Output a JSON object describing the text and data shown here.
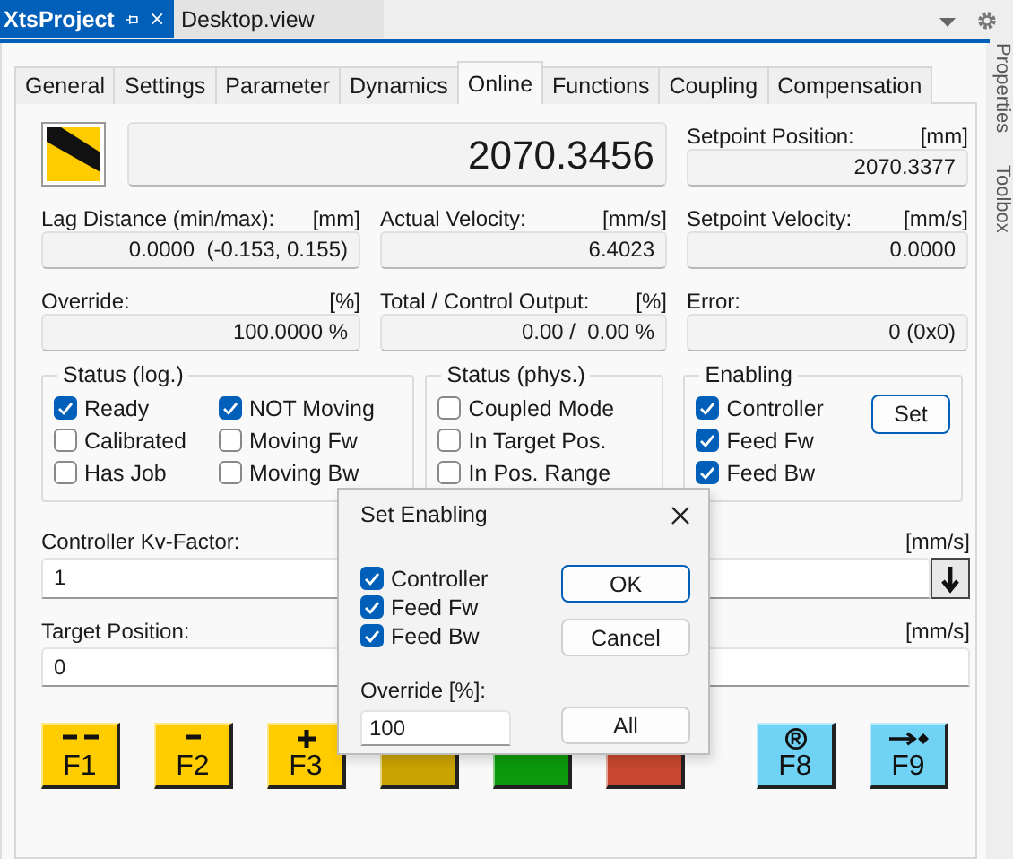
{
  "doc_tabs": [
    {
      "label": "XtsProject",
      "selected": true
    },
    {
      "label": "Desktop.view",
      "selected": false
    }
  ],
  "side_panels": [
    "Properties",
    "Toolbox"
  ],
  "tabs": [
    {
      "label": "General",
      "selected": false
    },
    {
      "label": "Settings",
      "selected": false
    },
    {
      "label": "Parameter",
      "selected": false
    },
    {
      "label": "Dynamics",
      "selected": false
    },
    {
      "label": "Online",
      "selected": true
    },
    {
      "label": "Functions",
      "selected": false
    },
    {
      "label": "Coupling",
      "selected": false
    },
    {
      "label": "Compensation",
      "selected": false
    }
  ],
  "position": {
    "value": "2070.3456"
  },
  "setpoint_position": {
    "label": "Setpoint Position:",
    "unit": "[mm]",
    "value": "2070.3377"
  },
  "field_rows": [
    [
      {
        "label": "Lag Distance (min/max):",
        "unit": "[mm]",
        "value": "0.0000  (-0.153, 0.155)"
      },
      {
        "label": "Actual Velocity:",
        "unit": "[mm/s]",
        "value": "6.4023"
      },
      {
        "label": "Setpoint Velocity:",
        "unit": "[mm/s]",
        "value": "0.0000"
      }
    ],
    [
      {
        "label": "Override:",
        "unit": "[%]",
        "value": "100.0000 %"
      },
      {
        "label": "Total / Control Output:",
        "unit": "[%]",
        "value": "0.00 /  0.00 %"
      },
      {
        "label": "Error:",
        "value": "0 (0x0)"
      }
    ]
  ],
  "status_log": {
    "title": "Status (log.)",
    "items": [
      {
        "label": "Ready",
        "checked": true
      },
      {
        "label": "NOT Moving",
        "checked": true
      },
      {
        "label": "Calibrated",
        "checked": false
      },
      {
        "label": "Moving Fw",
        "checked": false
      },
      {
        "label": "Has Job",
        "checked": false
      },
      {
        "label": "Moving Bw",
        "checked": false
      }
    ]
  },
  "status_phys": {
    "title": "Status (phys.)",
    "items": [
      {
        "label": "Coupled Mode",
        "checked": false
      },
      {
        "label": "In Target Pos.",
        "checked": false
      },
      {
        "label": "In Pos. Range",
        "checked": false
      }
    ]
  },
  "enabling": {
    "title": "Enabling",
    "items": [
      {
        "label": "Controller",
        "checked": true
      },
      {
        "label": "Feed Fw",
        "checked": true
      },
      {
        "label": "Feed Bw",
        "checked": true
      }
    ],
    "button": "Set"
  },
  "kv": {
    "label": "Controller Kv-Factor:",
    "unit": "[mm/s]",
    "value": "1"
  },
  "target": {
    "label": "Target Position:",
    "unit": "[mm/s]",
    "value": "0"
  },
  "function_keys": [
    {
      "label": "F1",
      "color": "#ffcc00",
      "kind": "double-dash"
    },
    {
      "label": "F2",
      "color": "#ffcc00",
      "kind": "dash"
    },
    {
      "label": "F3",
      "color": "#ffcc00",
      "kind": "plus"
    },
    {
      "color": "#c9a300",
      "kind": "hidden"
    },
    {
      "color": "#0c9a0c",
      "kind": "hidden"
    },
    {
      "color": "#c8472f",
      "kind": "hidden"
    },
    {
      "label": "F8",
      "color": "#70d2f5",
      "kind": "registered"
    },
    {
      "label": "F9",
      "color": "#70d2f5",
      "kind": "arrow-dot"
    }
  ],
  "dialog": {
    "title": "Set Enabling",
    "options": [
      {
        "label": "Controller",
        "checked": true
      },
      {
        "label": "Feed Fw",
        "checked": true
      },
      {
        "label": "Feed Bw",
        "checked": true
      }
    ],
    "override_label": "Override [%]:",
    "override_value": "100",
    "buttons": [
      {
        "label": "OK",
        "focused": true
      },
      {
        "label": "Cancel",
        "focused": false
      },
      {
        "label": "All",
        "focused": false
      }
    ]
  }
}
